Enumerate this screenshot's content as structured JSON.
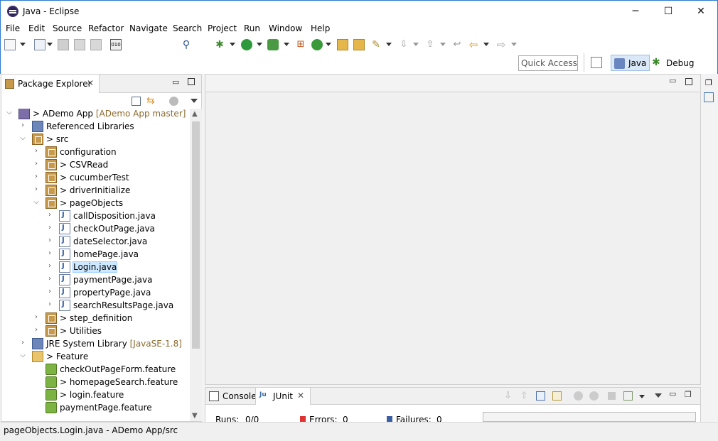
{
  "window": {
    "title": "Java - Eclipse",
    "minimize": "─",
    "maximize": "☐",
    "close": "✕"
  },
  "menu": [
    "File",
    "Edit",
    "Source",
    "Refactor",
    "Navigate",
    "Search",
    "Project",
    "Run",
    "Window",
    "Help"
  ],
  "toolbar": {
    "quick_access": "Quick Access",
    "perspectives": [
      {
        "label": "Java",
        "icon": "java-perspective-icon",
        "active": true
      },
      {
        "label": "Debug",
        "icon": "debug-perspective-icon",
        "active": false
      }
    ]
  },
  "package_explorer": {
    "tab_label": "Package Explorer",
    "tree": [
      {
        "level": 0,
        "twisty": "open",
        "icon": "project-icon",
        "prefix": "> ",
        "label": "ADemo App",
        "decoration": " [ADemo App master]"
      },
      {
        "level": 1,
        "twisty": "closed",
        "icon": "library-icon",
        "prefix": "",
        "label": "Referenced Libraries",
        "decoration": ""
      },
      {
        "level": 1,
        "twisty": "open",
        "icon": "source-folder-icon",
        "prefix": "> ",
        "label": "src",
        "decoration": ""
      },
      {
        "level": 2,
        "twisty": "closed",
        "icon": "package-icon",
        "prefix": "",
        "label": "configuration",
        "decoration": ""
      },
      {
        "level": 2,
        "twisty": "closed",
        "icon": "package-icon",
        "prefix": "> ",
        "label": "CSVRead",
        "decoration": ""
      },
      {
        "level": 2,
        "twisty": "closed",
        "icon": "package-icon",
        "prefix": "> ",
        "label": "cucumberTest",
        "decoration": ""
      },
      {
        "level": 2,
        "twisty": "closed",
        "icon": "package-icon",
        "prefix": "> ",
        "label": "driverInitialize",
        "decoration": ""
      },
      {
        "level": 2,
        "twisty": "open",
        "icon": "package-icon",
        "prefix": "> ",
        "label": "pageObjects",
        "decoration": ""
      },
      {
        "level": 3,
        "twisty": "closed",
        "icon": "java-file-icon",
        "prefix": "",
        "label": "callDisposition.java",
        "decoration": ""
      },
      {
        "level": 3,
        "twisty": "closed",
        "icon": "java-file-icon",
        "prefix": "",
        "label": "checkOutPage.java",
        "decoration": ""
      },
      {
        "level": 3,
        "twisty": "closed",
        "icon": "java-file-icon",
        "prefix": "",
        "label": "dateSelector.java",
        "decoration": ""
      },
      {
        "level": 3,
        "twisty": "closed",
        "icon": "java-file-icon",
        "prefix": "",
        "label": "homePage.java",
        "decoration": ""
      },
      {
        "level": 3,
        "twisty": "closed",
        "icon": "java-file-icon",
        "prefix": "",
        "label": "Login.java",
        "decoration": "",
        "selected": true
      },
      {
        "level": 3,
        "twisty": "closed",
        "icon": "java-file-icon",
        "prefix": "",
        "label": "paymentPage.java",
        "decoration": ""
      },
      {
        "level": 3,
        "twisty": "closed",
        "icon": "java-file-icon",
        "prefix": "",
        "label": "propertyPage.java",
        "decoration": ""
      },
      {
        "level": 3,
        "twisty": "closed",
        "icon": "java-file-icon",
        "prefix": "",
        "label": "searchResultsPage.java",
        "decoration": ""
      },
      {
        "level": 2,
        "twisty": "closed",
        "icon": "package-icon",
        "prefix": "> ",
        "label": "step_definition",
        "decoration": ""
      },
      {
        "level": 2,
        "twisty": "closed",
        "icon": "package-icon",
        "prefix": "> ",
        "label": "Utilities",
        "decoration": ""
      },
      {
        "level": 1,
        "twisty": "closed",
        "icon": "library-icon",
        "prefix": "",
        "label": "JRE System Library",
        "decoration": " [JavaSE-1.8]"
      },
      {
        "level": 1,
        "twisty": "open",
        "icon": "folder-icon",
        "prefix": "> ",
        "label": "Feature",
        "decoration": ""
      },
      {
        "level": 2,
        "twisty": "none",
        "icon": "feature-file-icon",
        "prefix": "",
        "label": "checkOutPageForm.feature",
        "decoration": ""
      },
      {
        "level": 2,
        "twisty": "none",
        "icon": "feature-file-icon",
        "prefix": "> ",
        "label": "homepageSearch.feature",
        "decoration": ""
      },
      {
        "level": 2,
        "twisty": "none",
        "icon": "feature-file-icon",
        "prefix": "> ",
        "label": "login.feature",
        "decoration": ""
      },
      {
        "level": 2,
        "twisty": "none",
        "icon": "feature-file-icon",
        "prefix": "",
        "label": "paymentPage.feature",
        "decoration": ""
      }
    ]
  },
  "bottom_panel": {
    "tabs": [
      {
        "label": "Console",
        "icon": "console-icon",
        "active": false
      },
      {
        "label": "JUnit",
        "icon": "junit-icon",
        "active": true
      }
    ],
    "runs_label": "Runs:",
    "runs_value": "0/0",
    "errors_label": "Errors:",
    "errors_value": "0",
    "failures_label": "Failures:",
    "failures_value": "0"
  },
  "status_bar": {
    "text": "pageObjects.Login.java - ADemo App/src"
  },
  "colors": {
    "accent": "#2b79d0",
    "selection": "#cde8ff",
    "decoration": "#8a6a2e"
  }
}
